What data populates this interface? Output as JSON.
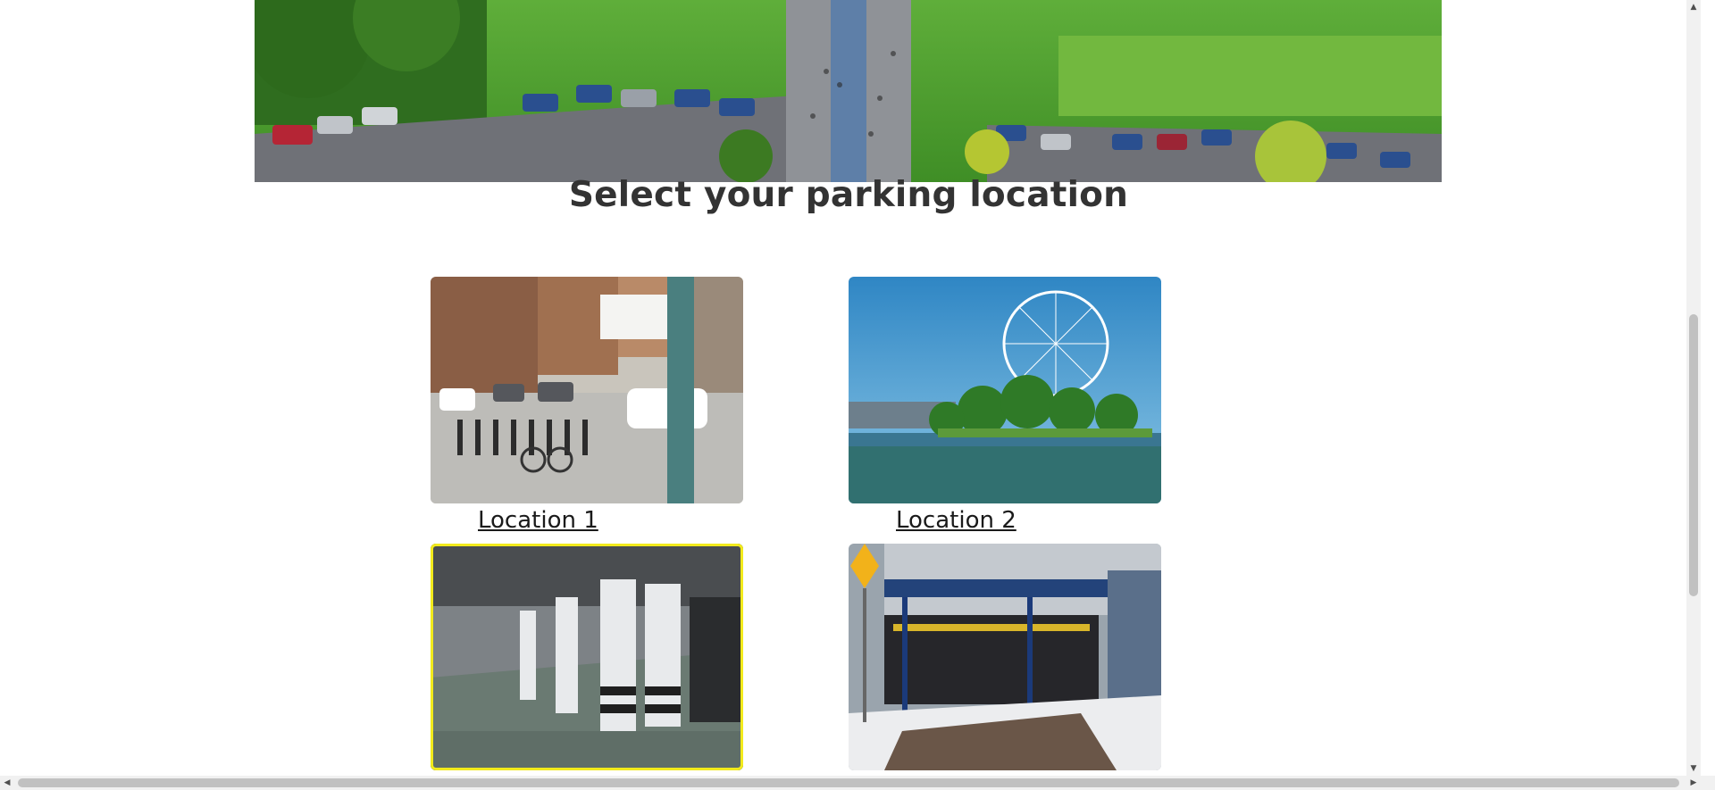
{
  "page": {
    "title": "Select your parking location"
  },
  "hero": {
    "image_name": "hero-park-stairs-image"
  },
  "locations": [
    {
      "label": "Location 1",
      "image": "street-bike-station-image",
      "selected": false
    },
    {
      "label": "Location 2",
      "image": "ferris-wheel-image",
      "selected": false
    },
    {
      "label": "",
      "image": "underground-garage-image",
      "selected": true
    },
    {
      "label": "",
      "image": "parking-entrance-image",
      "selected": false
    }
  ],
  "colors": {
    "selection_outline": "#f2ea1c",
    "text": "#333333"
  },
  "scrollbars": {
    "vertical_position_fraction": 0.44,
    "horizontal_position_fraction": 0.0
  }
}
